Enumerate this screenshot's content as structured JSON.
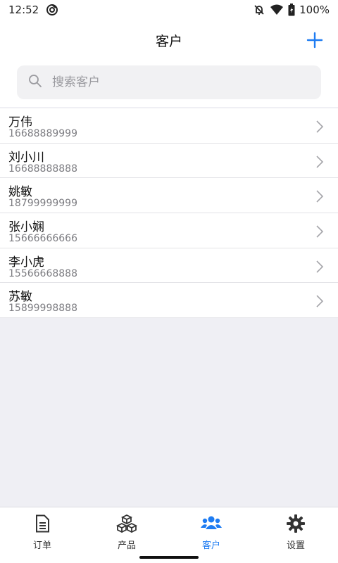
{
  "status": {
    "time": "12:52",
    "battery": "100%"
  },
  "header": {
    "title": "客户",
    "add_icon": "plus-icon"
  },
  "search": {
    "placeholder": "搜索客户",
    "value": ""
  },
  "customers": [
    {
      "name": "万伟",
      "phone": "16688889999"
    },
    {
      "name": "刘小川",
      "phone": "16688888888"
    },
    {
      "name": "姚敏",
      "phone": "18799999999"
    },
    {
      "name": "张小娴",
      "phone": "15666666666"
    },
    {
      "name": "李小虎",
      "phone": "15566668888"
    },
    {
      "name": "苏敏",
      "phone": "15899998888"
    }
  ],
  "tabs": [
    {
      "label": "订单",
      "icon": "document-icon",
      "active": false
    },
    {
      "label": "产品",
      "icon": "boxes-icon",
      "active": false
    },
    {
      "label": "客户",
      "icon": "users-icon",
      "active": true
    },
    {
      "label": "设置",
      "icon": "gear-icon",
      "active": false
    }
  ],
  "colors": {
    "accent": "#1e7cf2",
    "background": "#efeff4"
  }
}
